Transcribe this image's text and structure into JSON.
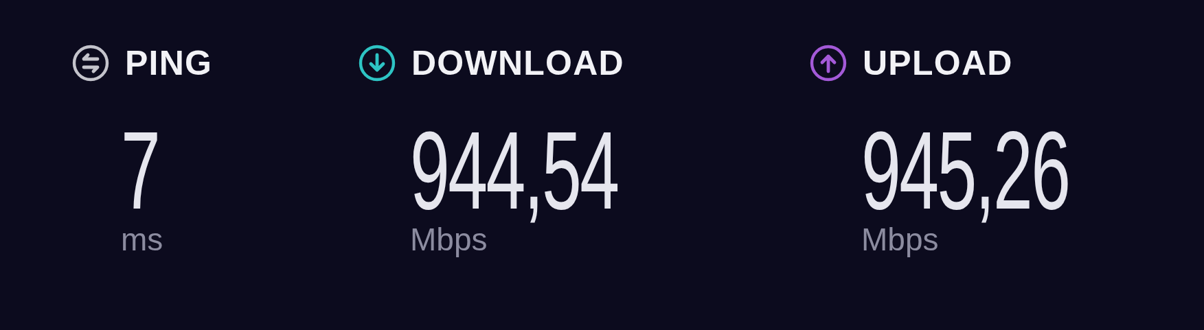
{
  "metrics": [
    {
      "kind": "ping",
      "label": "PING",
      "value": "7",
      "unit": "ms",
      "color": "#c4c4cc"
    },
    {
      "kind": "download",
      "label": "DOWNLOAD",
      "value": "944,54",
      "unit": "Mbps",
      "color": "#2ec4c4"
    },
    {
      "kind": "upload",
      "label": "UPLOAD",
      "value": "945,26",
      "unit": "Mbps",
      "color": "#a45ad8"
    }
  ]
}
